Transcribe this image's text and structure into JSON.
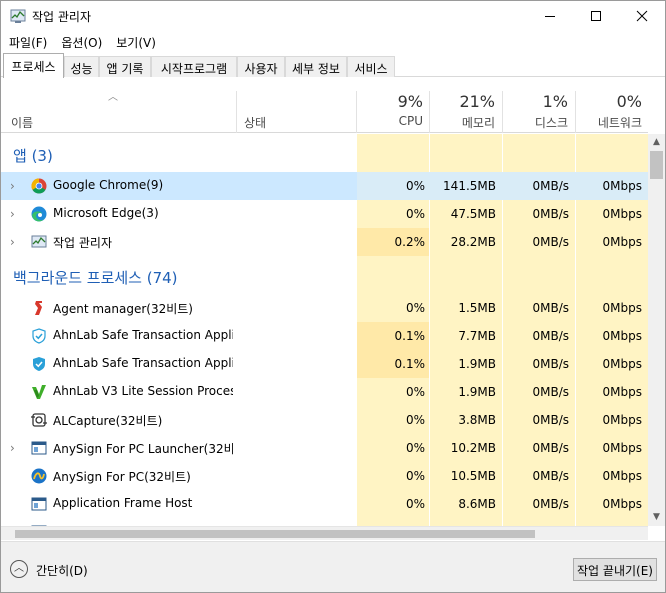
{
  "window": {
    "title": "작업 관리자"
  },
  "menu": [
    "파일(F)",
    "옵션(O)",
    "보기(V)"
  ],
  "tabs": [
    "프로세스",
    "성능",
    "앱 기록",
    "시작프로그램",
    "사용자",
    "세부 정보",
    "서비스"
  ],
  "columns": {
    "name": "이름",
    "status": "상태",
    "cpu": {
      "pct": "9%",
      "label": "CPU"
    },
    "memory": {
      "pct": "21%",
      "label": "메모리"
    },
    "disk": {
      "pct": "1%",
      "label": "디스크"
    },
    "network": {
      "pct": "0%",
      "label": "네트워크"
    }
  },
  "groups": {
    "apps": "앱 (3)",
    "background": "백그라운드 프로세스 (74)"
  },
  "apps": [
    {
      "name": "Google Chrome(9)",
      "cpu": "0%",
      "memory": "141.5MB",
      "disk": "0MB/s",
      "network": "0Mbps",
      "icon": "chrome-icon"
    },
    {
      "name": "Microsoft Edge(3)",
      "cpu": "0%",
      "memory": "47.5MB",
      "disk": "0MB/s",
      "network": "0Mbps",
      "icon": "edge-icon"
    },
    {
      "name": "작업 관리자",
      "cpu": "0.2%",
      "memory": "28.2MB",
      "disk": "0MB/s",
      "network": "0Mbps",
      "icon": "task-manager-icon"
    }
  ],
  "background": [
    {
      "name": "Agent manager(32비트)",
      "cpu": "0%",
      "memory": "1.5MB",
      "disk": "0MB/s",
      "network": "0Mbps",
      "icon": "agent-manager-icon"
    },
    {
      "name": "AhnLab Safe Transaction Appli...",
      "cpu": "0.1%",
      "memory": "7.7MB",
      "disk": "0MB/s",
      "network": "0Mbps",
      "icon": "ahnlab-shield-icon"
    },
    {
      "name": "AhnLab Safe Transaction Appli...",
      "cpu": "0.1%",
      "memory": "1.9MB",
      "disk": "0MB/s",
      "network": "0Mbps",
      "icon": "ahnlab-shield-icon"
    },
    {
      "name": "AhnLab V3 Lite Session Proces...",
      "cpu": "0%",
      "memory": "1.9MB",
      "disk": "0MB/s",
      "network": "0Mbps",
      "icon": "v3-icon"
    },
    {
      "name": "ALCapture(32비트)",
      "cpu": "0%",
      "memory": "3.8MB",
      "disk": "0MB/s",
      "network": "0Mbps",
      "icon": "alcapture-icon"
    },
    {
      "name": "AnySign For PC Launcher(32비...",
      "cpu": "0%",
      "memory": "10.2MB",
      "disk": "0MB/s",
      "network": "0Mbps",
      "icon": "window-app-icon"
    },
    {
      "name": "AnySign For PC(32비트)",
      "cpu": "0%",
      "memory": "10.5MB",
      "disk": "0MB/s",
      "network": "0Mbps",
      "icon": "anysign-icon"
    },
    {
      "name": "Application Frame Host",
      "cpu": "0%",
      "memory": "8.6MB",
      "disk": "0MB/s",
      "network": "0Mbps",
      "icon": "window-app-icon"
    }
  ],
  "footer": {
    "fewer_details": "간단히(D)",
    "end_task": "작업 끝내기(E)"
  },
  "colors": {
    "heat": "#fff4c4",
    "heat_strong": "#ffe9a8",
    "selected": "#cce8ff",
    "group": "#1f5fb5"
  }
}
